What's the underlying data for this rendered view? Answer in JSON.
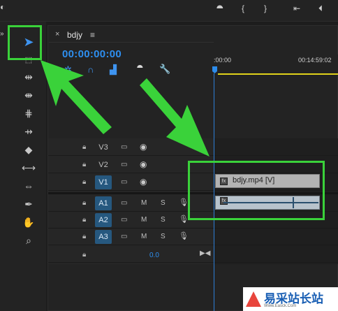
{
  "sequence": {
    "tab_close": "×",
    "name": "bdjy",
    "menu": "≡",
    "timecode": "00:00:00:00"
  },
  "ruler": {
    "start_label": ":00:00",
    "end_label": "00:14:59:02"
  },
  "tracks": {
    "video": [
      {
        "name": "V3",
        "targeted": false
      },
      {
        "name": "V2",
        "targeted": false
      },
      {
        "name": "V1",
        "targeted": true
      }
    ],
    "audio": [
      {
        "name": "A1",
        "mute": "M",
        "solo": "S"
      },
      {
        "name": "A2",
        "mute": "M",
        "solo": "S"
      },
      {
        "name": "A3",
        "mute": "M",
        "solo": "S"
      }
    ],
    "master_value": "0.0"
  },
  "clips": {
    "video_label": "bdjy.mp4 [V]",
    "fx_badge": "fx"
  },
  "tools": [
    "selection-tool",
    "track-select-forward-tool",
    "ripple-edit-tool",
    "rolling-edit-tool",
    "rate-stretch-tool",
    "razor-tool",
    "slip-tool",
    "slide-tool",
    "pen-tool",
    "hand-tool",
    "zoom-tool"
  ],
  "watermark": {
    "title": "易采站长站",
    "subtitle": "Www.Easck.Com"
  },
  "colors": {
    "accent_blue": "#2e8ff0",
    "highlight_green": "#3ad23a",
    "work_area_yellow": "#e0d21a"
  }
}
